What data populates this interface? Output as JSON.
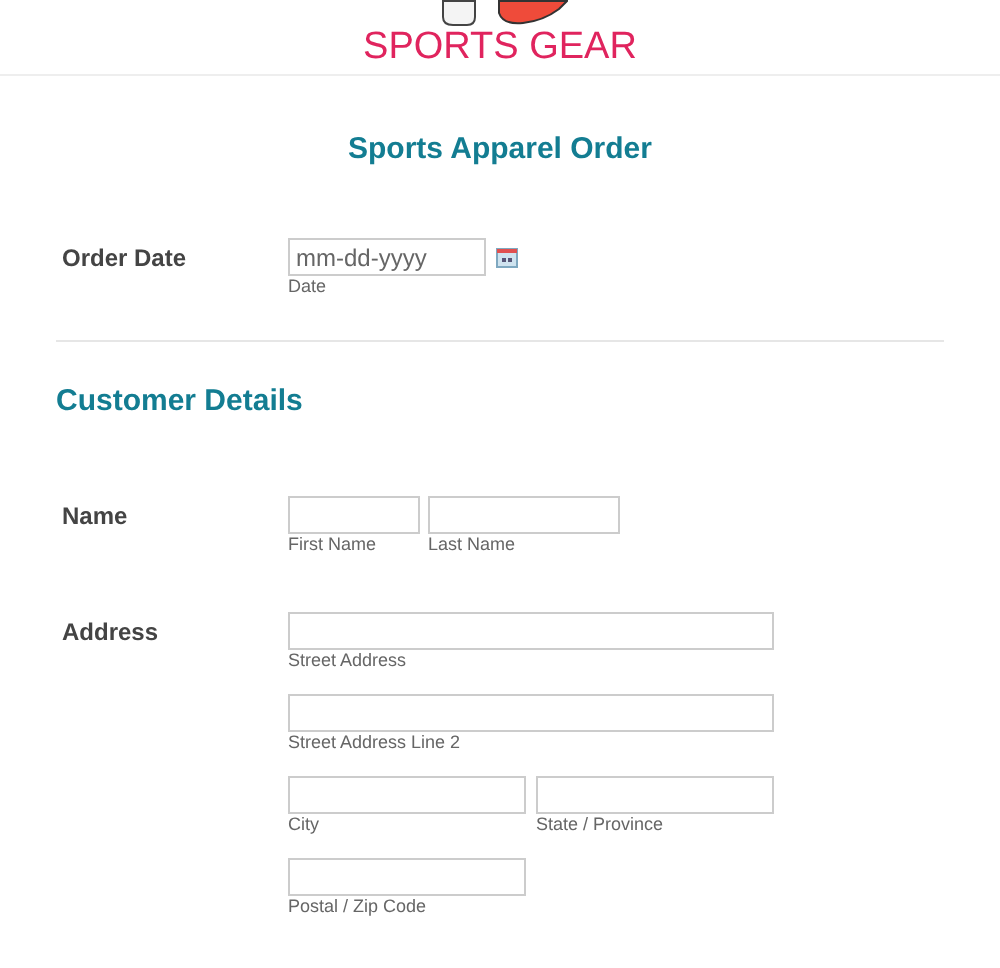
{
  "header": {
    "logo_text": "SPORTS GEAR"
  },
  "form": {
    "title": "Sports Apparel Order",
    "order_date": {
      "label": "Order Date",
      "placeholder": "mm-dd-yyyy",
      "sublabel": "Date"
    },
    "sections": [
      {
        "heading": "Customer Details",
        "fields": [
          {
            "kind": "name",
            "label": "Name",
            "inputs": [
              {
                "sublabel": "First Name"
              },
              {
                "sublabel": "Last Name"
              }
            ]
          },
          {
            "kind": "address",
            "label": "Address",
            "inputs": [
              {
                "sublabel": "Street Address"
              },
              {
                "sublabel": "Street Address Line 2"
              },
              {
                "sublabel": "City"
              },
              {
                "sublabel": "State / Province"
              },
              {
                "sublabel": "Postal / Zip Code"
              }
            ]
          }
        ]
      }
    ]
  }
}
